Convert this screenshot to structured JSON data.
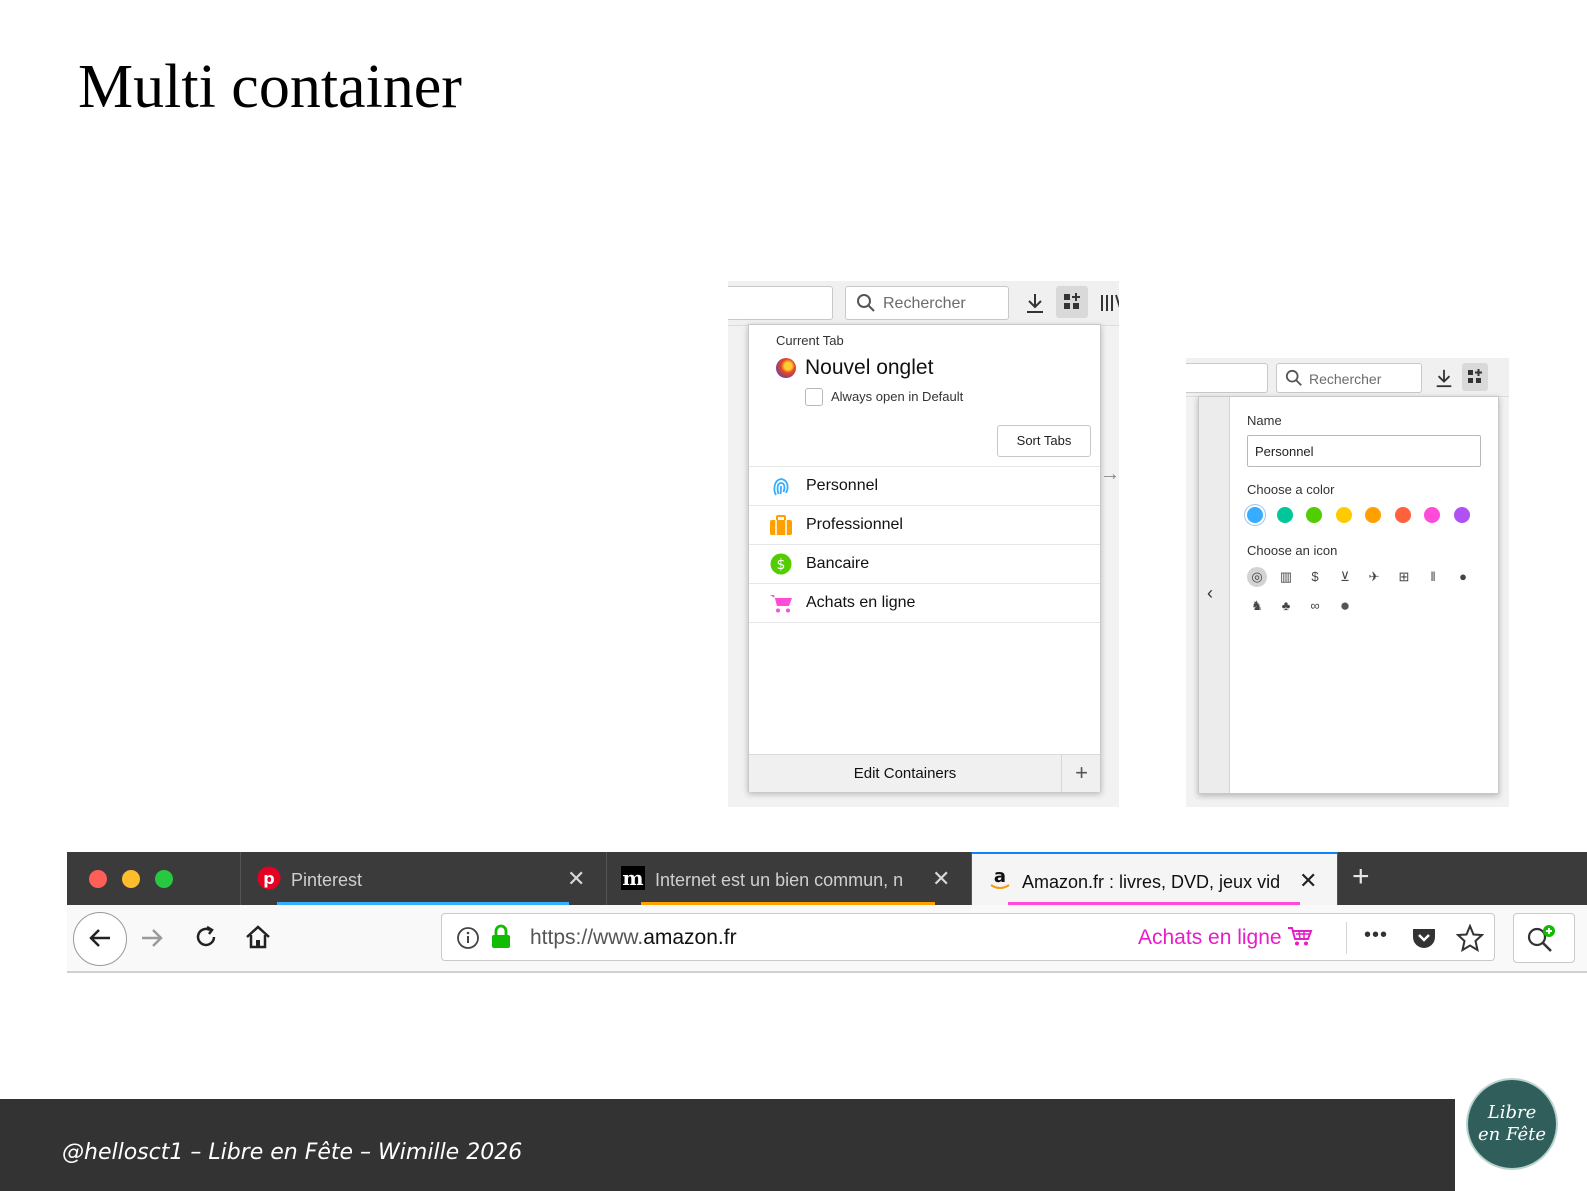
{
  "slide": {
    "title": "Multi container",
    "footer": "@hellosct1 – Libre en Fête – Wimille 2026",
    "logo": {
      "line1": "Libre",
      "line2": "en Fête"
    }
  },
  "popup": {
    "search_placeholder": "Rechercher",
    "current_tab_label": "Current Tab",
    "tab_title": "Nouvel onglet",
    "always_open_label": "Always open in Default",
    "sort_tabs": "Sort Tabs",
    "containers": [
      {
        "name": "Personnel",
        "color": "#37adff",
        "icon": "fingerprint-icon"
      },
      {
        "name": "Professionnel",
        "color": "#ff9f00",
        "icon": "briefcase-icon"
      },
      {
        "name": "Bancaire",
        "color": "#51cd00",
        "icon": "dollar-icon"
      },
      {
        "name": "Achats en ligne",
        "color": "#ff4bda",
        "icon": "cart-icon"
      }
    ],
    "edit_containers": "Edit Containers",
    "add_symbol": "+"
  },
  "editor": {
    "search_placeholder": "Rechercher",
    "name_label": "Name",
    "name_value": "Personnel",
    "color_label": "Choose a color",
    "colors": [
      "#37adff",
      "#00c79a",
      "#51cd00",
      "#ffcb00",
      "#ff9f00",
      "#ff613d",
      "#ff4bda",
      "#af51f5"
    ],
    "selected_color": "#37adff",
    "icon_label": "Choose an icon",
    "icons": [
      "fingerprint-icon",
      "briefcase-icon",
      "dollar-icon",
      "cart-icon",
      "vacation-icon",
      "gift-icon",
      "food-icon",
      "fruit-icon",
      "pet-icon",
      "tree-icon",
      "chill-icon",
      "circle-icon"
    ]
  },
  "browser": {
    "window_controls": {
      "close": "#ff5f57",
      "minimize": "#ffbd2e",
      "maximize": "#28c940"
    },
    "tabs": [
      {
        "label": "Pinterest",
        "icon": "pinterest-icon",
        "underline": "#37adff",
        "active": false
      },
      {
        "label": "Internet est un bien commun, n",
        "icon": "medium-icon",
        "underline": "#ff9f00",
        "active": false
      },
      {
        "label": "Amazon.fr : livres, DVD, jeux vid",
        "icon": "amazon-icon",
        "underline": "#ff4bda",
        "active": true
      }
    ],
    "new_tab": "+",
    "url_prefix": "https://www.",
    "url_domain": "amazon.fr",
    "container_label": "Achats en ligne",
    "more": "•••"
  }
}
